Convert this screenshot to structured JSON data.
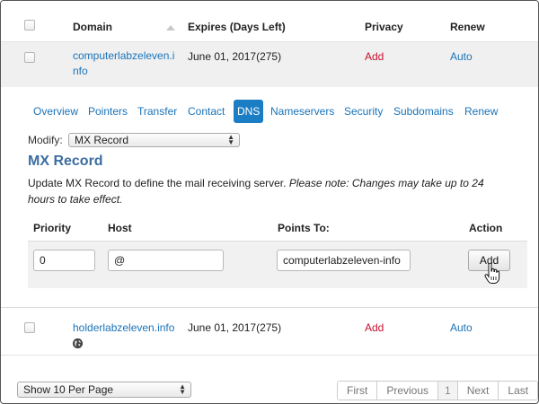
{
  "table": {
    "columns": {
      "domain": "Domain",
      "expires": "Expires (Days Left)",
      "privacy": "Privacy",
      "renew": "Renew"
    },
    "rows": [
      {
        "domain_line1": "computerlabzeleven.i",
        "domain_line2": "nfo",
        "expires": "June 01, 2017(275)",
        "privacy": "Add",
        "renew": "Auto"
      },
      {
        "domain_line1": "holderlabzeleven.info",
        "expires": "June 01, 2017(275)",
        "privacy": "Add",
        "renew": "Auto",
        "icon": "globe-icon"
      }
    ]
  },
  "tabs": [
    {
      "label": "Overview"
    },
    {
      "label": "Pointers"
    },
    {
      "label": "Transfer"
    },
    {
      "label": "Contact"
    },
    {
      "label": "DNS",
      "active": true
    },
    {
      "label": "Nameservers"
    },
    {
      "label": "Security"
    },
    {
      "label": "Subdomains"
    },
    {
      "label": "Renew"
    }
  ],
  "modify": {
    "label": "Modify:",
    "selected": "MX Record"
  },
  "section": {
    "title": "MX Record",
    "description_plain": "Update MX Record to define the mail receiving server. ",
    "description_note": "Please note: Changes may take up to 24 hours to take effect."
  },
  "mx_form": {
    "headers": {
      "priority": "Priority",
      "host": "Host",
      "points_to": "Points To:",
      "action": "Action"
    },
    "priority_value": "0",
    "host_value": "@",
    "points_to_value": "computerlabzeleven-info",
    "add_button": "Add"
  },
  "footer": {
    "per_page": "Show 10 Per Page",
    "pagination": {
      "first": "First",
      "previous": "Previous",
      "current": "1",
      "next": "Next",
      "last": "Last"
    }
  },
  "colors": {
    "link": "#1a73b8",
    "privacy_add": "#c8102e",
    "active_tab": "#1b7dc4",
    "section_title": "#3b6da0"
  }
}
